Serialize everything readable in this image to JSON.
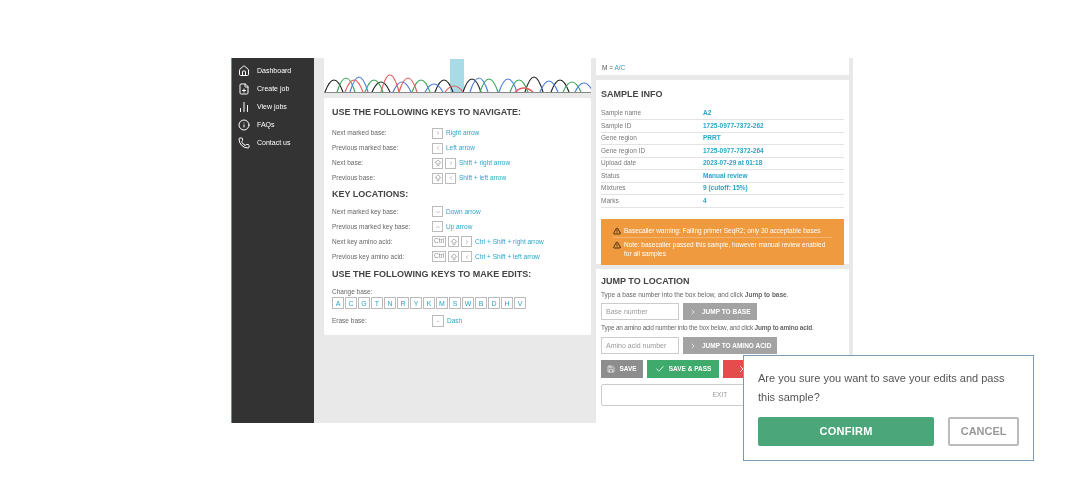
{
  "sidebar": {
    "items": [
      {
        "label": "Dashboard",
        "kind": "home"
      },
      {
        "label": "Create job",
        "kind": "create"
      },
      {
        "label": "View jobs",
        "kind": "chart"
      },
      {
        "label": "FAQs",
        "kind": "info"
      },
      {
        "label": "Contact us",
        "kind": "phone"
      }
    ]
  },
  "navigate": {
    "title": "USE THE FOLLOWING KEYS TO NAVIGATE:",
    "rows": [
      {
        "label": "Next marked base:",
        "keys": [
          {
            "kind": "right"
          }
        ],
        "action": "Right arrow"
      },
      {
        "label": "Previous marked base:",
        "keys": [
          {
            "kind": "left"
          }
        ],
        "action": "Left arrow"
      },
      {
        "label": "Next base:",
        "keys": [
          {
            "kind": "shift"
          },
          {
            "kind": "right"
          }
        ],
        "action": "Shift + right arrow"
      },
      {
        "label": "Previous base:",
        "keys": [
          {
            "kind": "shift"
          },
          {
            "kind": "left"
          }
        ],
        "action": "Shift + left arrow"
      }
    ]
  },
  "key_locations": {
    "title": "KEY LOCATIONS:",
    "rows": [
      {
        "label": "Next marked key base:",
        "keys": [
          {
            "kind": "down"
          }
        ],
        "action": "Down arrow"
      },
      {
        "label": "Previous marked key base:",
        "keys": [
          {
            "kind": "up"
          }
        ],
        "action": "Up arrow"
      },
      {
        "label": "Next key amino acid:",
        "keys": [
          {
            "kind": "text",
            "label": "Ctrl"
          },
          {
            "kind": "shift"
          },
          {
            "kind": "right"
          }
        ],
        "action": "Ctrl + Shift + right arrow"
      },
      {
        "label": "Previous key amino acid:",
        "keys": [
          {
            "kind": "text",
            "label": "Ctrl"
          },
          {
            "kind": "shift"
          },
          {
            "kind": "left"
          }
        ],
        "action": "Ctrl + Shift + left arrow"
      }
    ]
  },
  "edits": {
    "title": "USE THE FOLLOWING KEYS TO MAKE EDITS:",
    "change_label": "Change base:",
    "bases": [
      "A",
      "C",
      "G",
      "T",
      "N",
      "R",
      "Y",
      "K",
      "M",
      "S",
      "W",
      "B",
      "D",
      "H",
      "V"
    ],
    "erase_label": "Erase base:",
    "erase_key": "-",
    "erase_action": "Dash"
  },
  "legend": {
    "last_line_key": "M = ",
    "last_line_value": "A/C"
  },
  "sample_info": {
    "title": "SAMPLE INFO",
    "rows": [
      {
        "label": "Sample name",
        "value": "A2"
      },
      {
        "label": "Sample ID",
        "value": "1725-0977-7372-262"
      },
      {
        "label": "Gene region",
        "value": "PRRT"
      },
      {
        "label": "Gene region ID",
        "value": "1725-0977-7372-264"
      },
      {
        "label": "Upload date",
        "value": "2023-07-29 at 01:18"
      },
      {
        "label": "Status",
        "value": "Manual review"
      },
      {
        "label": "Mixtures",
        "value": "9 (cutoff: 15%)"
      },
      {
        "label": "Marks",
        "value": "4"
      }
    ],
    "warnings": [
      "Basecaller warning: Failing primer SeqR2; only 30 acceptable bases",
      "Note: basecaller passed this sample, however manual review enabled for all samples"
    ]
  },
  "jump": {
    "title": "JUMP TO LOCATION",
    "base_hint": "Type a base number into the box below, and click **Jump to base**.",
    "base_placeholder": "Base number",
    "base_button": "JUMP TO BASE",
    "aa_hint": "Type an amino acid number into the box below, and click **Jump to amino acid**.",
    "aa_placeholder": "Amino acid number",
    "aa_button": "JUMP TO AMINO ACID"
  },
  "actions": [
    {
      "label": "SAVE",
      "kind": "save"
    },
    {
      "label": "SAVE & PASS",
      "kind": "pass"
    },
    {
      "kind": "fail"
    }
  ],
  "exit": "EXIT",
  "dialog": {
    "message": "Are you sure you want to save your edits and pass this sample?",
    "confirm": "CONFIRM",
    "cancel": "CANCEL"
  }
}
